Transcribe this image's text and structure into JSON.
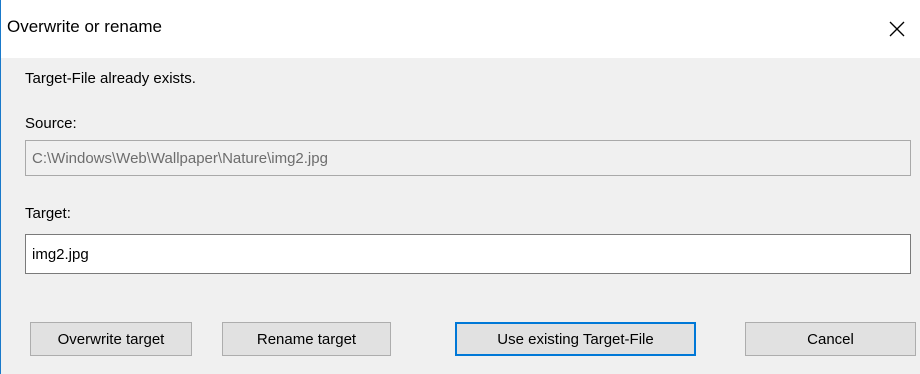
{
  "window": {
    "title": "Overwrite or rename"
  },
  "message": "Target-File already exists.",
  "source": {
    "label": "Source:",
    "value": "C:\\Windows\\Web\\Wallpaper\\Nature\\img2.jpg",
    "readonly": true
  },
  "target": {
    "label": "Target:",
    "value": "img2.jpg"
  },
  "buttons": {
    "overwrite": "Overwrite target",
    "rename": "Rename target",
    "use_existing": "Use existing Target-File",
    "cancel": "Cancel"
  },
  "icons": {
    "close": "close-icon"
  },
  "colors": {
    "accent": "#0078d7",
    "window_border": "#1979ca",
    "dialog_background": "#f0f0f0",
    "button_face": "#e1e1e1",
    "disabled_text": "#6d6d6d"
  }
}
